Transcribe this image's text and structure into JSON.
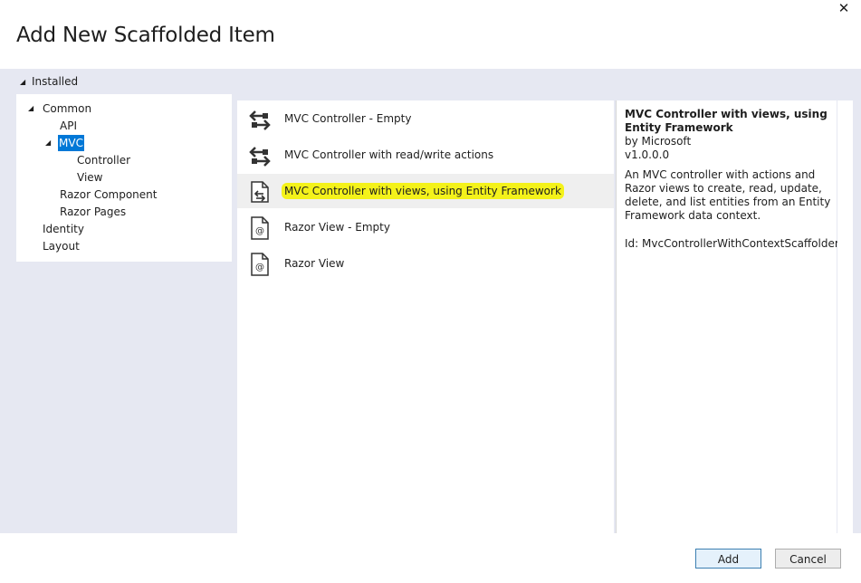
{
  "dialog": {
    "title": "Add New Scaffolded Item",
    "close_glyph": "✕"
  },
  "tree": {
    "root_label": "Installed",
    "items": [
      {
        "label": "Common",
        "level": 1,
        "expanded": true
      },
      {
        "label": "API",
        "level": 2
      },
      {
        "label": "MVC",
        "level": 2,
        "expanded": true,
        "selected": true
      },
      {
        "label": "Controller",
        "level": 3
      },
      {
        "label": "View",
        "level": 3
      },
      {
        "label": "Razor Component",
        "level": 2
      },
      {
        "label": "Razor Pages",
        "level": 2
      },
      {
        "label": "Identity",
        "level": 1
      },
      {
        "label": "Layout",
        "level": 1
      }
    ]
  },
  "templates": [
    {
      "label": "MVC Controller - Empty",
      "icon": "controller-arrows-icon"
    },
    {
      "label": "MVC Controller with read/write actions",
      "icon": "controller-arrows-icon"
    },
    {
      "label": "MVC Controller with views, using Entity Framework",
      "icon": "controller-document-icon",
      "selected": true,
      "highlighted": true
    },
    {
      "label": "Razor View - Empty",
      "icon": "razor-view-icon"
    },
    {
      "label": "Razor View",
      "icon": "razor-view-icon"
    }
  ],
  "details": {
    "title": "MVC Controller with views, using Entity Framework",
    "author": "by Microsoft",
    "version": "v1.0.0.0",
    "description": "An MVC controller with actions and Razor views to create, read, update, delete, and list entities from an Entity Framework data context.",
    "id": "Id: MvcControllerWithContextScaffolder"
  },
  "buttons": {
    "add": "Add",
    "cancel": "Cancel"
  },
  "colors": {
    "band": "#e6e8f2",
    "selection": "#0078d7",
    "highlight": "#f4f21a"
  }
}
